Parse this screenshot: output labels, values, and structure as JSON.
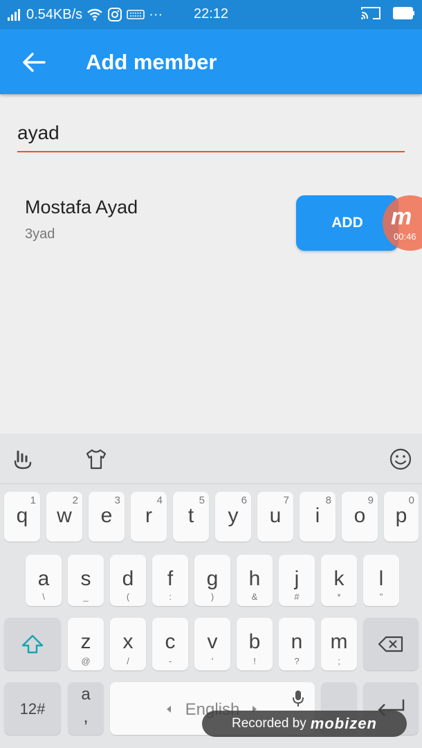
{
  "status_bar": {
    "network_speed": "0.54KB/s",
    "time": "22:12",
    "extra": "···"
  },
  "app_bar": {
    "title": "Add member"
  },
  "search": {
    "value": "ayad"
  },
  "member": {
    "name": "Mostafa Ayad",
    "handle": "3yad",
    "add_label": "ADD"
  },
  "recorder_bubble": {
    "time": "00:46",
    "letter": "m"
  },
  "keyboard": {
    "row1": [
      {
        "main": "q",
        "hint": "1"
      },
      {
        "main": "w",
        "hint": "2"
      },
      {
        "main": "e",
        "hint": "3"
      },
      {
        "main": "r",
        "hint": "4"
      },
      {
        "main": "t",
        "hint": "5"
      },
      {
        "main": "y",
        "hint": "6"
      },
      {
        "main": "u",
        "hint": "7"
      },
      {
        "main": "i",
        "hint": "8"
      },
      {
        "main": "o",
        "hint": "9"
      },
      {
        "main": "p",
        "hint": "0"
      }
    ],
    "row2": [
      {
        "main": "a",
        "sub": "\\"
      },
      {
        "main": "s",
        "sub": "_"
      },
      {
        "main": "d",
        "sub": "("
      },
      {
        "main": "f",
        "sub": ":"
      },
      {
        "main": "g",
        "sub": ")"
      },
      {
        "main": "h",
        "sub": "&"
      },
      {
        "main": "j",
        "sub": "#"
      },
      {
        "main": "k",
        "sub": "*"
      },
      {
        "main": "l",
        "sub": "\""
      }
    ],
    "row3": [
      {
        "main": "z",
        "sub": "@"
      },
      {
        "main": "x",
        "sub": "/"
      },
      {
        "main": "c",
        "sub": "-"
      },
      {
        "main": "v",
        "sub": "'"
      },
      {
        "main": "b",
        "sub": "!"
      },
      {
        "main": "n",
        "sub": "?"
      },
      {
        "main": "m",
        "sub": ";"
      }
    ],
    "numbers_label": "12#",
    "comma_key": {
      "main": "a",
      "sub": ","
    },
    "space_label": "English"
  },
  "watermark": {
    "text": "Recorded by",
    "logo": "mobizen"
  },
  "colors": {
    "primary": "#2196f3",
    "status_bar": "#1e88d6",
    "underline": "#f4511e"
  }
}
